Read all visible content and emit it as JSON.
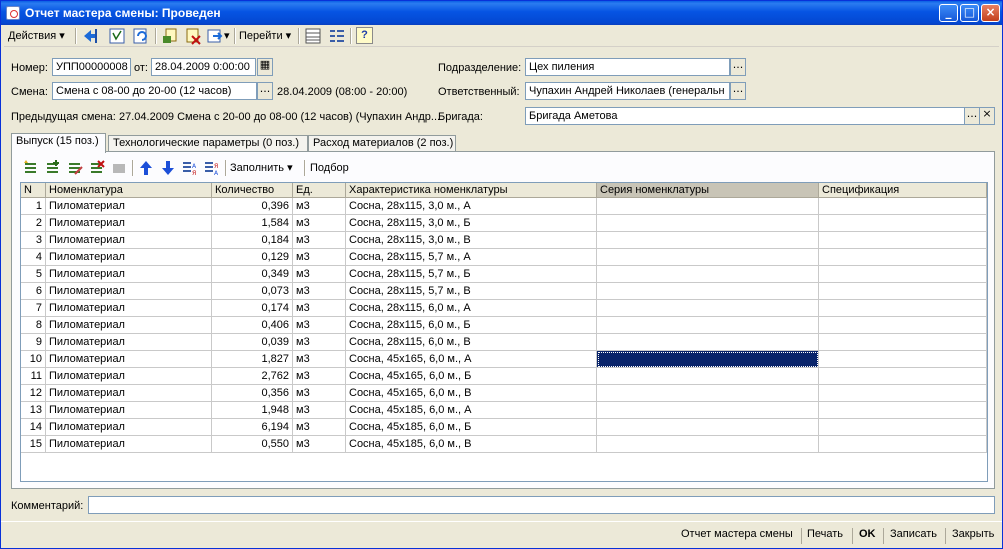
{
  "window": {
    "title": "Отчет мастера смены: Проведен"
  },
  "toolbar": {
    "actions_label": "Действия",
    "goto_label": "Перейти",
    "help_label": "?"
  },
  "header": {
    "number_label": "Номер:",
    "number_value": "УПП00000008",
    "date_label": "от:",
    "date_value": "28.04.2009  0:00:00",
    "shift_label": "Смена:",
    "shift_value": "Смена с 08-00 до 20-00 (12 часов)",
    "shift_period": "28.04.2009 (08:00 - 20:00)",
    "prev_shift_label": "Предыдущая смена:",
    "prev_shift_value": "27.04.2009 Смена с 20-00 до 08-00 (12 часов) (Чупахин Андр...",
    "division_label": "Подразделение:",
    "division_value": "Цех пиления",
    "responsible_label": "Ответственный:",
    "responsible_value": "Чупахин Андрей Николаев (генеральн",
    "brigade_label": "Бригада:",
    "brigade_value": "Бригада Аметова",
    "pick_glyph": "...",
    "clear_glyph": "×"
  },
  "tabs": [
    {
      "label": "Выпуск (15 поз.)",
      "active": true
    },
    {
      "label": "Технологические параметры (0 поз.)",
      "active": false
    },
    {
      "label": "Расход материалов (2 поз.)",
      "active": false
    }
  ],
  "panel_toolbar": {
    "fill_label": "Заполнить",
    "select_label": "Подбор"
  },
  "table": {
    "columns": [
      "N",
      "Номенклатура",
      "Количество",
      "Ед.",
      "Характеристика номенклатуры",
      "Серия номенклатуры",
      "Спецификация"
    ],
    "selected_row": 10,
    "rows": [
      [
        "1",
        "Пиломатериал",
        "0,396",
        "м3",
        "Сосна, 28х115, 3,0 м., А",
        "",
        ""
      ],
      [
        "2",
        "Пиломатериал",
        "1,584",
        "м3",
        "Сосна, 28х115, 3,0 м., Б",
        "",
        ""
      ],
      [
        "3",
        "Пиломатериал",
        "0,184",
        "м3",
        "Сосна, 28х115, 3,0 м., В",
        "",
        ""
      ],
      [
        "4",
        "Пиломатериал",
        "0,129",
        "м3",
        "Сосна, 28х115, 5,7 м., А",
        "",
        ""
      ],
      [
        "5",
        "Пиломатериал",
        "0,349",
        "м3",
        "Сосна, 28х115, 5,7 м., Б",
        "",
        ""
      ],
      [
        "6",
        "Пиломатериал",
        "0,073",
        "м3",
        "Сосна, 28х115, 5,7 м., В",
        "",
        ""
      ],
      [
        "7",
        "Пиломатериал",
        "0,174",
        "м3",
        "Сосна, 28х115, 6,0 м., А",
        "",
        ""
      ],
      [
        "8",
        "Пиломатериал",
        "0,406",
        "м3",
        "Сосна, 28х115, 6,0 м., Б",
        "",
        ""
      ],
      [
        "9",
        "Пиломатериал",
        "0,039",
        "м3",
        "Сосна, 28х115, 6,0 м., В",
        "",
        ""
      ],
      [
        "10",
        "Пиломатериал",
        "1,827",
        "м3",
        "Сосна, 45х165, 6,0 м., А",
        "",
        ""
      ],
      [
        "11",
        "Пиломатериал",
        "2,762",
        "м3",
        "Сосна, 45х165, 6,0 м., Б",
        "",
        ""
      ],
      [
        "12",
        "Пиломатериал",
        "0,356",
        "м3",
        "Сосна, 45х165, 6,0 м., В",
        "",
        ""
      ],
      [
        "13",
        "Пиломатериал",
        "1,948",
        "м3",
        "Сосна, 45х185, 6,0 м., А",
        "",
        ""
      ],
      [
        "14",
        "Пиломатериал",
        "6,194",
        "м3",
        "Сосна, 45х185, 6,0 м., Б",
        "",
        ""
      ],
      [
        "15",
        "Пиломатериал",
        "0,550",
        "м3",
        "Сосна, 45х185, 6,0 м., В",
        "",
        ""
      ]
    ]
  },
  "comment": {
    "label": "Комментарий:",
    "value": ""
  },
  "footer": {
    "report_label": "Отчет мастера смены",
    "print_label": "Печать",
    "ok_label": "OK",
    "save_label": "Записать",
    "close_label": "Закрыть"
  },
  "colors": {
    "title_bar": "#0654e3",
    "window_bg": "#ece9d8",
    "selection": "#0a246a"
  }
}
